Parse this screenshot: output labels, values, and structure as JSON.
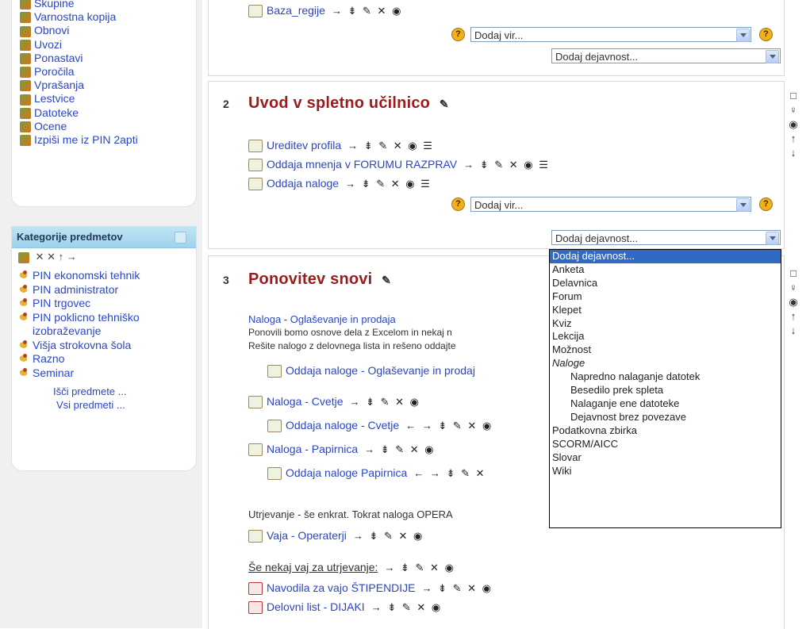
{
  "admin_block": {
    "items": [
      {
        "label": "Skupine",
        "icon": "groups-icon"
      },
      {
        "label": "Varnostna kopija",
        "icon": "backup-icon"
      },
      {
        "label": "Obnovi",
        "icon": "restore-icon"
      },
      {
        "label": "Uvozi",
        "icon": "import-icon"
      },
      {
        "label": "Ponastavi",
        "icon": "reset-icon"
      },
      {
        "label": "Poročila",
        "icon": "reports-icon"
      },
      {
        "label": "Vprašanja",
        "icon": "questions-icon"
      },
      {
        "label": "Lestvice",
        "icon": "scales-icon"
      },
      {
        "label": "Datoteke",
        "icon": "folder-icon"
      },
      {
        "label": "Ocene",
        "icon": "grades-icon"
      },
      {
        "label": "Izpiši me iz PIN 2apti",
        "icon": "unenrol-icon"
      }
    ]
  },
  "categories_block": {
    "title": "Kategorije predmetov",
    "tools": "✕ ✕ ↑ →",
    "items": [
      "PIN ekonomski tehnik",
      "PIN administrator",
      "PIN trgovec",
      "PIN poklicno tehniško izobraževanje",
      "Višja strokovna šola",
      "Razno",
      "Seminar"
    ],
    "search_link": "Išči predmete ...",
    "all_link": "Vsi predmeti ..."
  },
  "section1": {
    "activity": "Baza_regije",
    "tools": "→ ⇟ ✎ ✕ ◉",
    "add_resource": "Dodaj vir...",
    "add_activity": "Dodaj dejavnost..."
  },
  "section2": {
    "number": "2",
    "title": "Uvod v spletno učilnico",
    "edit_icon": "✎",
    "activities": [
      {
        "label": "Ureditev profila",
        "tools": "→ ⇟ ✎ ✕ ◉ ☰"
      },
      {
        "label": "Oddaja mnenja v FORUMU RAZPRAV",
        "tools": "→ ⇟ ✎ ✕ ◉ ☰"
      },
      {
        "label": "Oddaja naloge",
        "tools": "→ ⇟ ✎ ✕ ◉ ☰"
      }
    ],
    "add_resource": "Dodaj vir...",
    "add_activity": "Dodaj dejavnost..."
  },
  "section3": {
    "number": "3",
    "title": "Ponovitev snovi",
    "edit_icon": "✎",
    "intro_link": "Naloga - Oglaševanje in prodaja",
    "intro_text1": "Ponovili bomo osnove dela z Excelom in nekaj n",
    "intro_text2": "Rešite nalogo z delovnega lista in rešeno oddajte",
    "activities": [
      {
        "label": "Oddaja naloge - Oglaševanje in prodaj",
        "tools": ""
      },
      {
        "label": "Naloga - Cvetje",
        "tools": "→ ⇟ ✎ ✕ ◉"
      },
      {
        "label": "Oddaja naloge - Cvetje",
        "tools": "← → ⇟ ✎ ✕ ◉"
      },
      {
        "label": "Naloga - Papirnica",
        "tools": "→ ⇟ ✎ ✕ ◉"
      },
      {
        "label": "Oddaja naloge Papirnica",
        "tools": "← → ⇟ ✎ ✕"
      }
    ],
    "practice_text": "Utrjevanje - še enkrat. Tokrat naloga OPERA",
    "practice_link": "Vaja - Operaterji",
    "practice_tools": "→ ⇟ ✎ ✕ ◉",
    "more_label": "Še nekaj vaj za utrjevanje:",
    "more_tools": "→ ⇟ ✎ ✕ ◉",
    "doc1": "Navodila za vajo ŠTIPENDIJE",
    "doc1_tools": "→ ⇟ ✎ ✕ ◉",
    "doc2": "Delovni list - DIJAKI",
    "doc2_tools": "→ ⇟ ✎ ✕ ◉"
  },
  "dropdown": {
    "options": [
      {
        "label": "Dodaj dejavnost...",
        "kind": "selected"
      },
      {
        "label": "Anketa",
        "kind": "item"
      },
      {
        "label": "Delavnica",
        "kind": "item"
      },
      {
        "label": "Forum",
        "kind": "item"
      },
      {
        "label": "Klepet",
        "kind": "item"
      },
      {
        "label": "Kviz",
        "kind": "item"
      },
      {
        "label": "Lekcija",
        "kind": "item"
      },
      {
        "label": "Možnost",
        "kind": "item"
      },
      {
        "label": "Naloge",
        "kind": "group"
      },
      {
        "label": "Napredno nalaganje datotek",
        "kind": "sub"
      },
      {
        "label": "Besedilo prek spleta",
        "kind": "sub"
      },
      {
        "label": "Nalaganje ene datoteke",
        "kind": "sub"
      },
      {
        "label": "Dejavnost brez povezave",
        "kind": "sub"
      },
      {
        "label": "Podatkovna zbirka",
        "kind": "item"
      },
      {
        "label": "SCORM/AICC",
        "kind": "item"
      },
      {
        "label": "Slovar",
        "kind": "item"
      },
      {
        "label": "Wiki",
        "kind": "item"
      }
    ]
  },
  "right_icons": [
    "□",
    "♀",
    "◉",
    "↑",
    "↓"
  ]
}
